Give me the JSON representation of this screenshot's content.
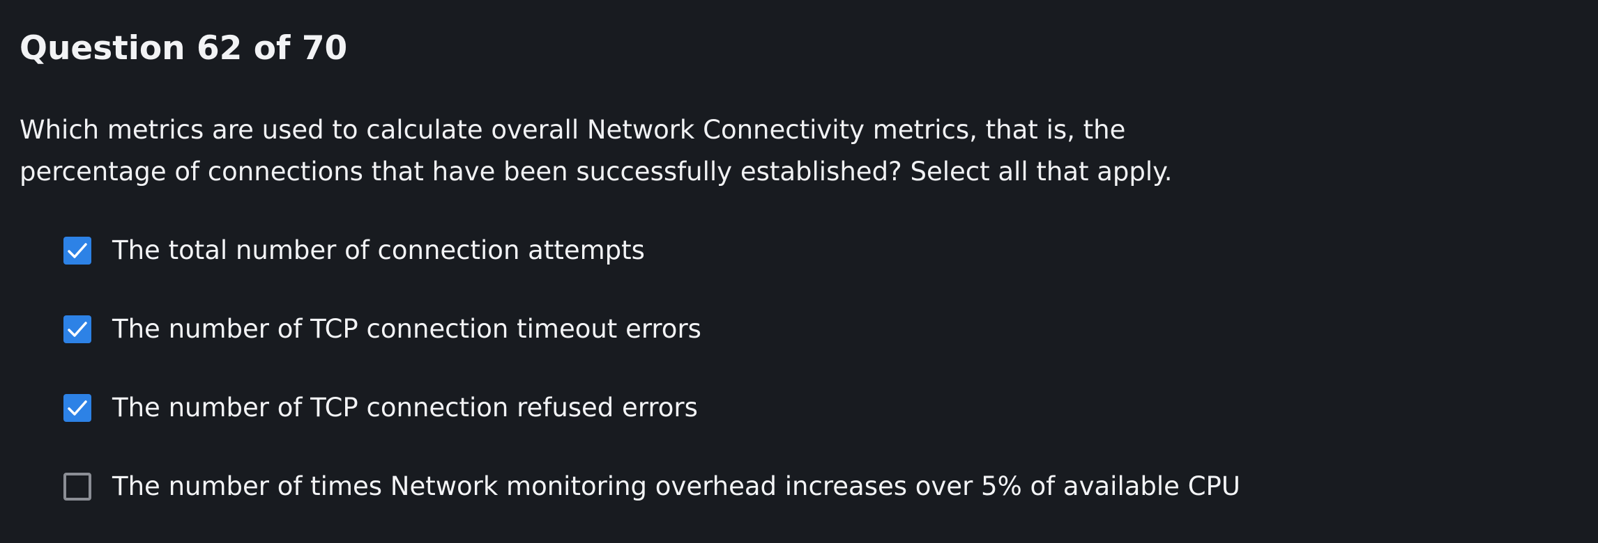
{
  "quiz": {
    "title": "Question 62 of 70",
    "question_line_1": "Which metrics are used to calculate overall Network Connectivity metrics, that is, the",
    "question_line_2": "percentage of connections that have been successfully established? Select all that apply.",
    "options": [
      {
        "label": "The total number of connection attempts",
        "checked": true,
        "icon": "checkmark-icon"
      },
      {
        "label": "The number of TCP connection timeout errors",
        "checked": true,
        "icon": "checkmark-icon"
      },
      {
        "label": "The number of TCP connection refused errors",
        "checked": true,
        "icon": "checkmark-icon"
      },
      {
        "label": "The number of times Network monitoring overhead increases over 5% of available CPU",
        "checked": false,
        "icon": "empty-checkbox-icon"
      }
    ]
  },
  "colors": {
    "background": "#181b20",
    "text": "#f2f3f5",
    "checked_box": "#2d82e6",
    "unchecked_border": "#8b8e95"
  }
}
